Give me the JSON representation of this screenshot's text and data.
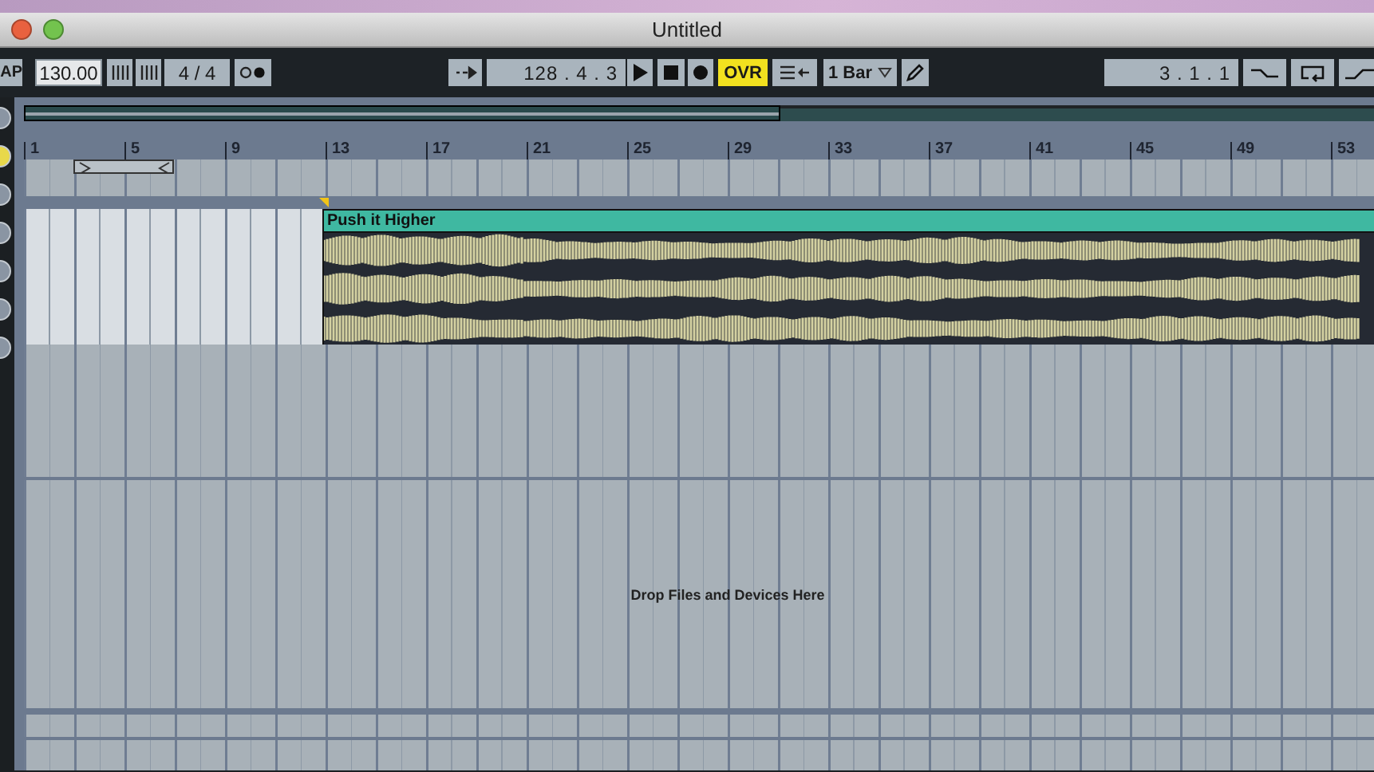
{
  "window": {
    "title": "Untitled"
  },
  "toolbar": {
    "tap_label": "AP",
    "tempo": "130.00",
    "time_signature": "4 / 4",
    "position": "128 . 4 . 3",
    "overdub": {
      "label": "OVR",
      "on": true
    },
    "quantize": "1 Bar",
    "loop_length": "3 . 1 . 1"
  },
  "side_buttons": [
    {
      "selected": false
    },
    {
      "selected": true
    },
    {
      "selected": false
    },
    {
      "selected": false
    },
    {
      "selected": false
    },
    {
      "selected": false
    },
    {
      "selected": false
    }
  ],
  "ruler": {
    "labels": [
      "1",
      "5",
      "9",
      "13",
      "17",
      "21",
      "25",
      "29",
      "33",
      "37",
      "41",
      "45",
      "49",
      "53"
    ]
  },
  "clip": {
    "name": "Push it Higher"
  },
  "drop_hint": "Drop Files and Devices Here"
}
